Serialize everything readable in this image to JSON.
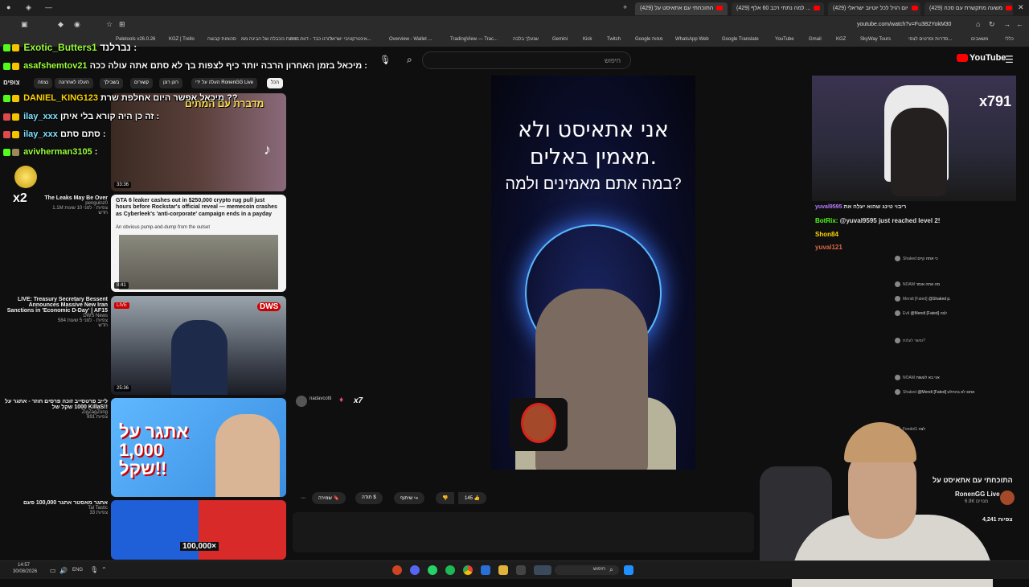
{
  "browser": {
    "tabs": [
      {
        "label": "(429) התוכחתי עם אתאיסט על"
      },
      {
        "label": "(429) למה נתתי רכב 60 אלף ..."
      },
      {
        "label": "(429) יום רגיל לכל יוטיוב ישראלי"
      },
      {
        "label": "(429) משעה מתקשרת עם סכה"
      }
    ],
    "url": "youtube.com/watch?v=Fu3B2YokM30",
    "bookmarks": [
      "Paletools v26.0.26",
      "KGZ | Trello",
      "סכומות קבוצה",
      "הכנת כוכבלה של הבינה ממ...",
      "דורנו כבד - דווח דוייה",
      "אינטרקטיבי ישראל...",
      "Overview - Wallet ...",
      "TradingView — Trac...",
      "שנעלך בלבה",
      "Gemini",
      "Kick",
      "Twitch",
      "Google מפות",
      "WhatsApp Web",
      "Google Translate",
      "YouTube",
      "Gmail",
      "KGZ",
      "SkyWay Tours",
      "סדרות וסרטים לצפי...",
      "משאבים",
      "כללי"
    ]
  },
  "youtube": {
    "search_placeholder": "חיפוש",
    "logo": "YouTube",
    "chips": [
      "הכל",
      "העלה על ידי RonenGG Live",
      "רונן רונן",
      "קשורים",
      "בשבילך",
      "העלה לאחרונה",
      "נצפה"
    ],
    "sidebar_watching": "צופים",
    "player": {
      "line1": "אני אתאיסט ולא",
      "line2": "מאמין באלים.",
      "line3": "במה אתם מאמינים ולמה?"
    },
    "recommended": [
      {
        "title": "מדברת עם המתים",
        "duration": "33:36"
      },
      {
        "title": "The Leaks May Be Over",
        "channel": "penguinz0",
        "meta": "1.1M צפיות · לפני 10 שעות",
        "extra": "חדש",
        "duration": "8:41",
        "headline": "GTA 6 leaker cashes out in $250,000 crypto rug pull just hours before Rockstar's official reveal — memecoin crashes as Cyberleek's 'anti-corporate' campaign ends in a payday",
        "headline_sub": "An obvious pump-and-dump from the outset"
      },
      {
        "title": "LIVE: Treasury Secretary Bessent Announces Massive New Iran Sanctions in 'Economic D-Day' | AF15",
        "channel": "DWS News",
        "meta": "584 צפיות · לפני 5 שעות",
        "extra": "חדש",
        "duration": "25:36",
        "live_label": "LIVE",
        "brand": "DWS"
      },
      {
        "title": "לייב פרטסייב זוכה פרסים חוזר - אתגר על 1000 שקל של KillaS!!",
        "channel": "ZigZagZong",
        "meta": "891 צפיות",
        "thumb_text": "אתגר על 1,000 שקל!!"
      },
      {
        "title": "אתגר מאסטר אתגר 100,000 פעם",
        "channel": "Tal Tastic",
        "meta": "33 צפיות",
        "thumb_text": "100,000×"
      }
    ],
    "actions": {
      "like_count": "145",
      "share": "שיתוף",
      "thanks": "תודה",
      "save": "שמירה"
    },
    "channel": {
      "name": "RonenGG Live",
      "subs": "6.9K מנויים",
      "video_title": "התוכחתי עם אתאיסט על",
      "views": "4,241 צפיות"
    },
    "sticker_user": "nadavcotti",
    "sticker_count": "x7"
  },
  "overlay_chat": [
    {
      "name": "Exotic_Butters1",
      "msg": "נברלנד :"
    },
    {
      "name": "asafshemtov21",
      "msg": "מיכאל בזמן האחרון הרבה יותר כיף לצפות בך לא סתם אתה עולה ככה :"
    },
    {
      "name": "DANIEL_KING123",
      "msg": "מיכאל אפשר היום אחלפת שרת ??"
    },
    {
      "name": "ilay_xxx",
      "msg": "זה כן היה קורא בלי איתן :"
    },
    {
      "name": "ilay_xxx",
      "msg": "סתם סתם :"
    },
    {
      "name": "avivherman3105",
      "msg": ":"
    }
  ],
  "overlay_badge": "x2",
  "stream_chat": [
    {
      "user": "yuval9595",
      "msg": "ריבוי טינג שהוא יעלה את"
    },
    {
      "user": "BotRix",
      "msg": "@yuval9595 just reached level 2!"
    },
    {
      "user": "Shon84",
      "msg": ""
    },
    {
      "user": "yuval121",
      "msg": ""
    }
  ],
  "right_chat": [
    {
      "user": "Shaked",
      "msg": "כי אתה קיים"
    },
    {
      "user": "NOAM",
      "msg": "מה אתה אומר"
    },
    {
      "user": "Mendi [Fated]",
      "msg": "@Shaked p."
    },
    {
      "user": "Evil",
      "msg": "@Mendi [Fated] לצה"
    },
    {
      "user": "ופשר לעלות?",
      "msg": ""
    },
    {
      "user": "NOAM",
      "msg": "אני בא לעשות"
    },
    {
      "user": "Shaked",
      "msg": "@Mendi [Fated] אתם לא בהחלט"
    },
    {
      "user": "FeedoG",
      "msg": "לצה"
    }
  ],
  "cam_label": "x791",
  "taskbar": {
    "time": "14:57",
    "date": "30/08/2026",
    "lang": "ENG",
    "search": "חיפוש"
  }
}
